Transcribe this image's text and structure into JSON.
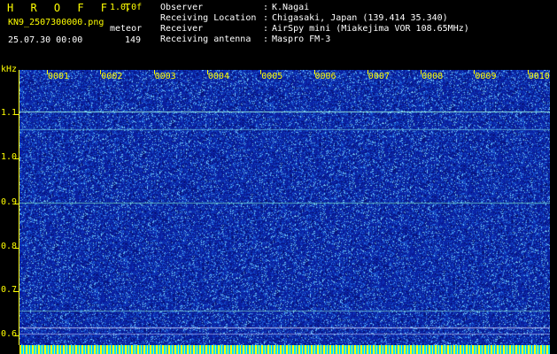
{
  "header": {
    "app_title": "H R O F F T",
    "version": "1.0.0f",
    "filename": "KN9_2507300000.png",
    "meteor_label": "meteor",
    "datetime": "25.07.30 00:00",
    "meteor_count": "149"
  },
  "info": [
    {
      "label": "Observer",
      "value": "K.Nagai"
    },
    {
      "label": "Receiving Location",
      "value": "Chigasaki, Japan (139.414 35.340)"
    },
    {
      "label": "Receiver",
      "value": "AirSpy mini (Miakejima VOR 108.65MHz)"
    },
    {
      "label": "Receiving antenna",
      "value": "Maspro FM-3"
    }
  ],
  "plot": {
    "y_unit": "kHz",
    "y_ticks": [
      "1.1",
      "1.0",
      "0.9",
      "0.8",
      "0.7",
      "0.6"
    ],
    "x_ticks": [
      "0001",
      "0002",
      "0003",
      "0004",
      "0005",
      "0006",
      "0007",
      "0008",
      "0009",
      "0010"
    ],
    "background_color": "#0a2aa6",
    "accent_color": "#ffff00"
  }
}
